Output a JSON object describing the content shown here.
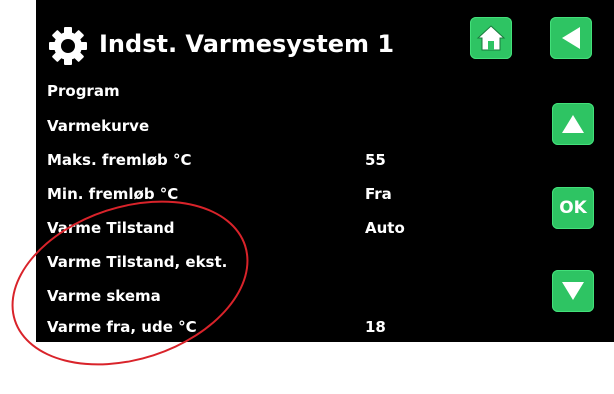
{
  "header": {
    "title": "Indst. Varmesystem 1",
    "gear_icon": "gear-icon",
    "home_icon": "home-icon",
    "back_icon": "back-arrow-icon"
  },
  "menu": {
    "items": [
      {
        "label": "Program",
        "value": ""
      },
      {
        "label": "Varmekurve",
        "value": ""
      },
      {
        "label": "Maks. fremløb °C",
        "value": "55"
      },
      {
        "label": "Min. fremløb °C",
        "value": "Fra"
      },
      {
        "label": "Varme Tilstand",
        "value": "Auto"
      },
      {
        "label": "Varme Tilstand, ekst.",
        "value": ""
      },
      {
        "label": "Varme skema",
        "value": ""
      },
      {
        "label": "Varme fra, ude °C",
        "value": "18"
      }
    ]
  },
  "nav": {
    "up_icon": "arrow-up-icon",
    "ok_label": "OK",
    "down_icon": "arrow-down-icon"
  },
  "colors": {
    "button": "#2ec463",
    "background": "#000000",
    "text": "#ffffff",
    "annotation": "#d9232a"
  }
}
